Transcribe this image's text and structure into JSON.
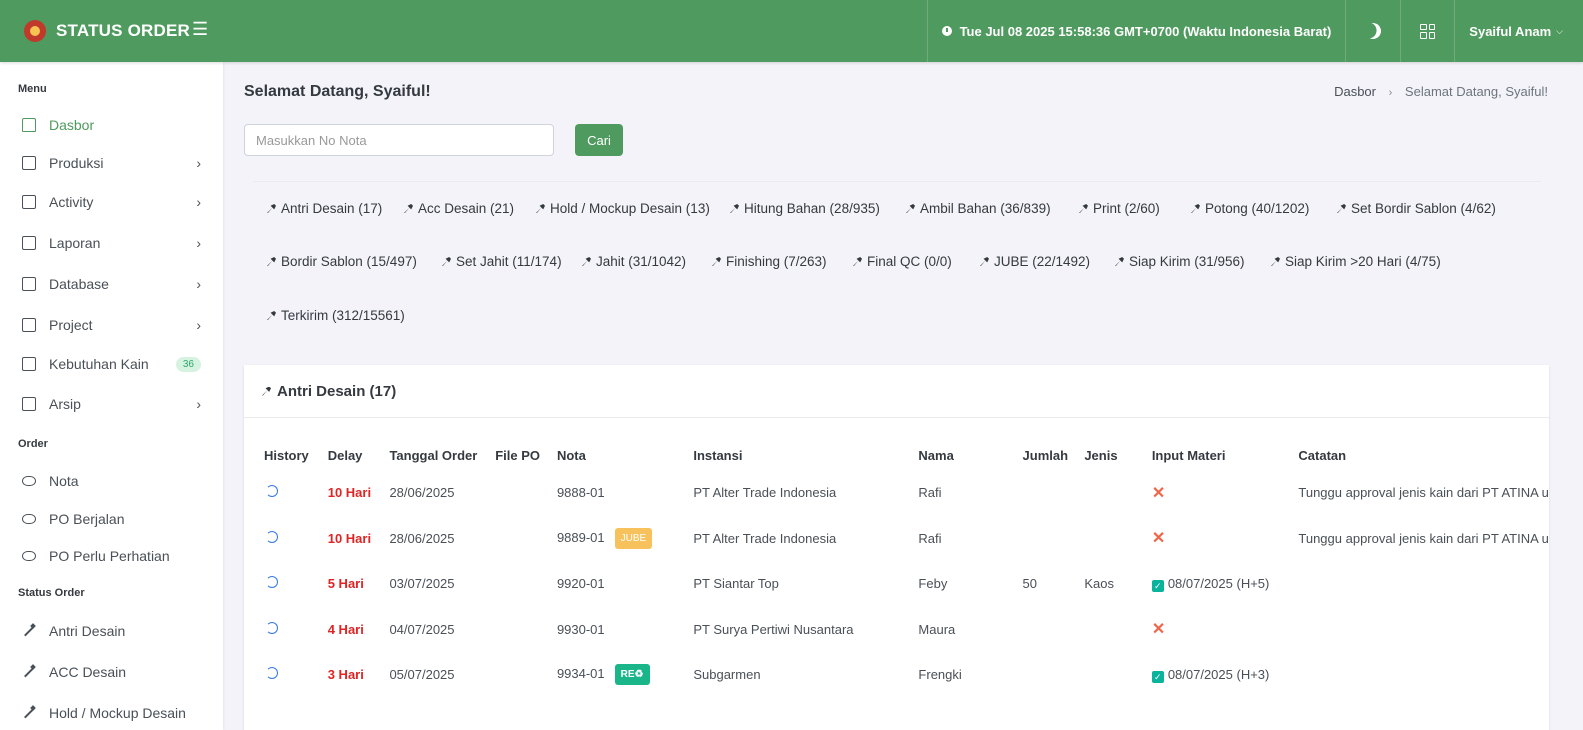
{
  "app": {
    "title": "STATUS ORDER"
  },
  "header": {
    "datetime": "Tue Jul 08 2025 15:58:36 GMT+0700 (Waktu Indonesia Barat)",
    "user": "Syaiful Anam"
  },
  "sidebar": {
    "section_menu": "Menu",
    "section_order": "Order",
    "section_status": "Status Order",
    "menu": [
      {
        "label": "Dasbor"
      },
      {
        "label": "Produksi"
      },
      {
        "label": "Activity"
      },
      {
        "label": "Laporan"
      },
      {
        "label": "Database"
      },
      {
        "label": "Project"
      },
      {
        "label": "Kebutuhan Kain",
        "badge": "36"
      },
      {
        "label": "Arsip"
      }
    ],
    "order": [
      {
        "label": "Nota"
      },
      {
        "label": "PO Berjalan"
      },
      {
        "label": "PO Perlu Perhatian"
      }
    ],
    "status": [
      {
        "label": "Antri Desain"
      },
      {
        "label": "ACC Desain"
      },
      {
        "label": "Hold / Mockup Desain"
      }
    ]
  },
  "main": {
    "greeting": "Selamat Datang, Syaiful!",
    "breadcrumb": {
      "root": "Dasbor",
      "current": "Selamat Datang, Syaiful!"
    },
    "search": {
      "placeholder": "Masukkan No Nota",
      "button": "Cari"
    },
    "tabs": [
      "Antri Desain (17)",
      "Acc Desain (21)",
      "Hold / Mockup Desain (13)",
      "Hitung Bahan (28/935)",
      "Ambil Bahan (36/839)",
      "Print (2/60)",
      "Potong (40/1202)",
      "Set Bordir Sablon (4/62)",
      "Bordir Sablon (15/497)",
      "Set Jahit (11/174)",
      "Jahit (31/1042)",
      "Finishing (7/263)",
      "Final QC (0/0)",
      "JUBE (22/1492)",
      "Siap Kirim (31/956)",
      "Siap Kirim >20 Hari (4/75)",
      "Terkirim (312/15561)"
    ],
    "card_title": "Antri Desain (17)",
    "table": {
      "headers": [
        "History",
        "Delay",
        "Tanggal Order",
        "File PO",
        "Nota",
        "Instansi",
        "Nama",
        "Jumlah",
        "Jenis",
        "Input Materi",
        "Catatan"
      ],
      "rows": [
        {
          "delay": "10 Hari",
          "date": "28/06/2025",
          "nota": "9888-01",
          "tag": "",
          "instansi": "PT Alter Trade Indonesia",
          "nama": "Rafi",
          "jumlah": "",
          "jenis": "",
          "materi": "",
          "catatan": "Tunggu approval jenis kain dari PT ATINA u"
        },
        {
          "delay": "10 Hari",
          "date": "28/06/2025",
          "nota": "9889-01",
          "tag": "JUBE",
          "instansi": "PT Alter Trade Indonesia",
          "nama": "Rafi",
          "jumlah": "",
          "jenis": "",
          "materi": "",
          "catatan": "Tunggu approval jenis kain dari PT ATINA u"
        },
        {
          "delay": "5 Hari",
          "date": "03/07/2025",
          "nota": "9920-01",
          "tag": "",
          "instansi": "PT Siantar Top",
          "nama": "Feby",
          "jumlah": "50",
          "jenis": "Kaos",
          "materi": "08/07/2025 (H+5)",
          "catatan": ""
        },
        {
          "delay": "4 Hari",
          "date": "04/07/2025",
          "nota": "9930-01",
          "tag": "",
          "instansi": "PT Surya Pertiwi Nusantara",
          "nama": "Maura",
          "jumlah": "",
          "jenis": "",
          "materi": "",
          "catatan": ""
        },
        {
          "delay": "3 Hari",
          "date": "05/07/2025",
          "nota": "9934-01",
          "tag": "RE♻",
          "instansi": "Subgarmen",
          "nama": "Frengki",
          "jumlah": "",
          "jenis": "",
          "materi": "08/07/2025 (H+3)",
          "catatan": ""
        }
      ]
    }
  },
  "colors": {
    "brand": "#4f9a5e",
    "danger": "#e02424",
    "jube": "#f7c25c",
    "re": "#1bb58a"
  }
}
